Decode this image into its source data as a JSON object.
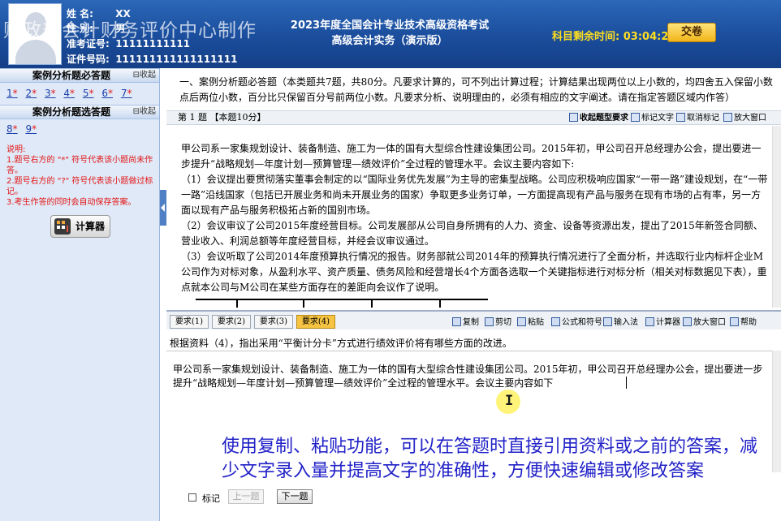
{
  "header": {
    "candidate": {
      "name_label": "姓  名:",
      "name_value": "XX",
      "gender_label": "性  别:",
      "gender_value": "男",
      "ticket_label": "准考证号:",
      "ticket_value": "11111111111",
      "id_label": "证件号码:",
      "id_value": "111111111111111111"
    },
    "watermark": "财政部会计财务评价中心制作",
    "title_line1": "2023年度全国会计专业技术高级资格考试",
    "title_line2": "高级会计实务（演示版）",
    "timer_label": "科目剩余时间:",
    "timer_value": "03:04:20",
    "submit_label": "交卷"
  },
  "sidebar": {
    "required_header": "案例分析题必答题",
    "collapse_label": "⊟收起",
    "required_items": [
      {
        "num": "1",
        "mark": "*"
      },
      {
        "num": "2",
        "mark": "*"
      },
      {
        "num": "3",
        "mark": "*"
      },
      {
        "num": "4",
        "mark": "*"
      },
      {
        "num": "5",
        "mark": "*"
      },
      {
        "num": "6",
        "mark": "*"
      },
      {
        "num": "7",
        "mark": "*"
      }
    ],
    "optional_header": "案例分析题选答题",
    "optional_items": [
      {
        "num": "8",
        "mark": "*"
      },
      {
        "num": "9",
        "mark": "*"
      }
    ],
    "notes": [
      "说明:",
      "1.题号右方的  \"*\" 符号代表该小题尚未作答。",
      "2.题号右方的  \"?\" 符号代表该小题做过标记。",
      "3.考生作答的同时会自动保存答案。"
    ],
    "calculator_label": "计算器"
  },
  "main": {
    "instructions": "一、案例分析题必答题（本类题共7题，共80分。凡要求计算的，可不列出计算过程；计算结果出现两位以上小数的，均四舍五入保留小数点后两位小数，百分比只保留百分号前两位小数。凡要求分析、说明理由的，必须有相应的文字阐述。请在指定答题区域内作答）",
    "question_title": "第  1  题  【本题10分】",
    "toolbar": {
      "collapse": "收起题型要求",
      "mark_text": "标记文字",
      "cancel_mark": "取消标记",
      "enlarge": "放大窗口"
    },
    "material": [
      "甲公司系一家集规划设计、装备制造、施工为一体的国有大型综合性建设集团公司。2015年初，甲公司召开总经理办公会，提出要进一步提升“战略规划—年度计划—预算管理—绩效评价”全过程的管理水平。会议主要内容如下:",
      "（1）会议提出要贯彻落实董事会制定的以“国际业务优先发展”为主导的密集型战略。公司应积极响应国家“一带一路”建设规划，在“一带一路”沿线国家（包括已开展业务和尚未开展业务的国家）争取更多业务订单，一方面提高现有产品与服务在现有市场的占有率，另一方面以现有产品与服务积极拓占新的国别市场。",
      "（2）会议审议了公司2015年度经营目标。公司发展部从公司自身所拥有的人力、资金、设备等资源出发，提出了2015年新签合同额、营业收入、利润总额等年度经营目标，并经会议审议通过。",
      "（3）会议听取了公司2014年度预算执行情况的报告。财务部就公司2014年的预算执行情况进行了全面分析，并选取行业内标杆企业M公司作为对标对象，从盈利水平、资产质量、债务风险和经营增长4个方面各选取一个关键指标进行对标分析（相关对标数据见下表），重点就本公司与M公司在某些方面存在的差距向会议作了说明。"
    ],
    "answer_tabs": [
      "要求(1)",
      "要求(2)",
      "要求(3)",
      "要求(4)"
    ],
    "answer_toolbar": {
      "copy": "复制",
      "cut": "剪切",
      "paste": "粘贴",
      "formula": "公式和符号",
      "input_method": "输入法",
      "calculator": "计算器",
      "enlarge": "放大窗口",
      "help": "帮助"
    },
    "requirement_text": "根据资料（4），指出采用“平衡计分卡”方式进行绩效评价将有哪些方面的改进。",
    "answer_text": "甲公司系一家集规划设计、装备制造、施工为一体的国有大型综合性建设集团公司。2015年初，甲公司召开总经理办公会，提出要进一步提升“战略规划—年度计划—预算管理—绩效评价”全过程的管理水平。会议主要内容如下",
    "cursor_glyph": "I",
    "subtitle": "使用复制、粘贴功能，可以在答题时直接引用资料或之前的答案，减少文字录入量并提高文字的准确性，方便快速编辑或修改答案",
    "mark_label": "标记",
    "prev_label": "上一题",
    "next_label": "下一题"
  },
  "colors": {
    "header_blue": "#1a4d9c",
    "timer_yellow": "#ffde20",
    "note_red": "#e31414",
    "active_tab": "#f6c342",
    "subtitle_blue": "#2222c8"
  }
}
